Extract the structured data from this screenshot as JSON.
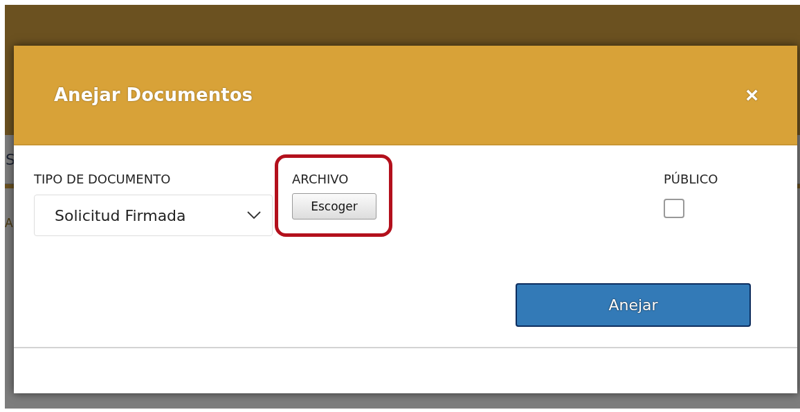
{
  "background_page": {
    "fragments": [
      "S",
      "A"
    ]
  },
  "dialog": {
    "title": "Anejar Documentos",
    "close": "×",
    "fields": [
      {
        "kind": "select",
        "label": "TIPO DE DOCUMENTO",
        "value": "Solicitud Firmada",
        "highlighted": false
      },
      {
        "kind": "file",
        "label": "ARCHIVO",
        "button": "Escoger",
        "highlighted": true
      },
      {
        "kind": "checkbox",
        "label": "PÚBLICO",
        "checked": false,
        "highlighted": false
      }
    ],
    "submit": "Anejar"
  }
}
